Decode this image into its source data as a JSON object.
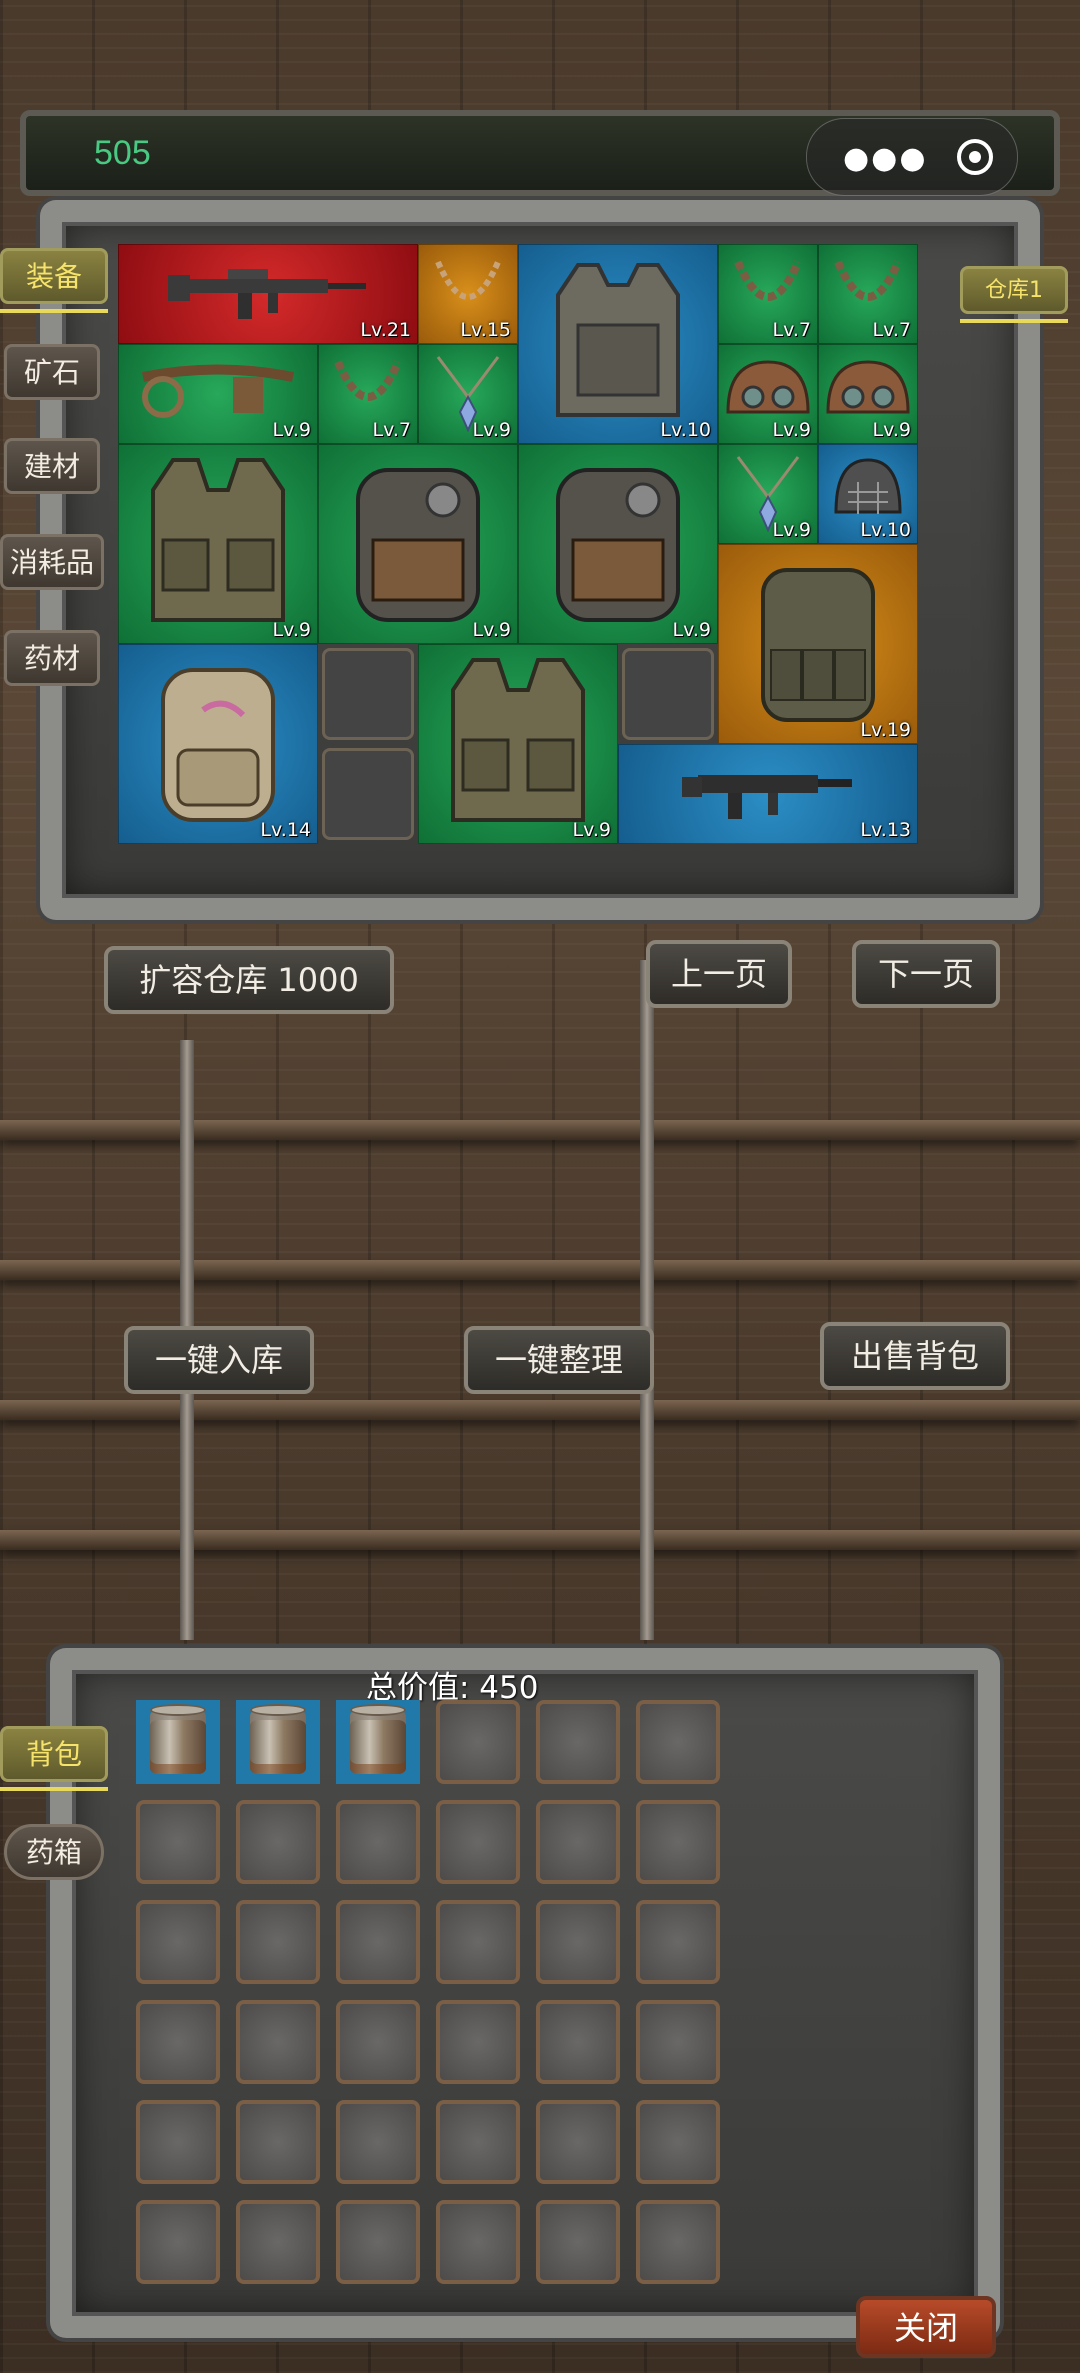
{
  "top_bar": {
    "coins": "505"
  },
  "left_tabs": [
    {
      "label": "装备",
      "active": true
    },
    {
      "label": "矿石",
      "active": false
    },
    {
      "label": "建材",
      "active": false
    },
    {
      "label": "消耗品",
      "active": false
    },
    {
      "label": "药材",
      "active": false
    }
  ],
  "warehouse_tab": {
    "label": "仓库1"
  },
  "items": [
    {
      "name": "rifle-icon",
      "lv": "Lv.21",
      "bg": "red"
    },
    {
      "name": "necklace-icon",
      "lv": "Lv.15",
      "bg": "orange"
    },
    {
      "name": "armor-vest-icon",
      "lv": "Lv.10",
      "bg": "blue"
    },
    {
      "name": "necklace-icon",
      "lv": "Lv.7",
      "bg": "green"
    },
    {
      "name": "necklace-icon",
      "lv": "Lv.7",
      "bg": "green"
    },
    {
      "name": "belt-icon",
      "lv": "Lv.9",
      "bg": "green"
    },
    {
      "name": "necklace-icon",
      "lv": "Lv.7",
      "bg": "green"
    },
    {
      "name": "crystal-pendant-icon",
      "lv": "Lv.9",
      "bg": "green"
    },
    {
      "name": "helmet-icon",
      "lv": "Lv.9",
      "bg": "green"
    },
    {
      "name": "helmet-icon",
      "lv": "Lv.9",
      "bg": "green"
    },
    {
      "name": "tactical-vest-icon",
      "lv": "Lv.9",
      "bg": "green"
    },
    {
      "name": "tool-backpack-icon",
      "lv": "Lv.9",
      "bg": "green"
    },
    {
      "name": "tool-backpack-icon",
      "lv": "Lv.9",
      "bg": "green"
    },
    {
      "name": "crystal-pendant-icon",
      "lv": "Lv.9",
      "bg": "green"
    },
    {
      "name": "cage-helmet-icon",
      "lv": "Lv.10",
      "bg": "blue"
    },
    {
      "name": "military-backpack-icon",
      "lv": "Lv.19",
      "bg": "orange"
    },
    {
      "name": "camo-backpack-icon",
      "lv": "Lv.14",
      "bg": "blue"
    },
    {
      "name": "tactical-vest-icon",
      "lv": "Lv.9",
      "bg": "green"
    },
    {
      "name": "smg-icon",
      "lv": "Lv.13",
      "bg": "blue"
    }
  ],
  "buttons": {
    "expand": "扩容仓库 1000",
    "prev": "上一页",
    "next": "下一页",
    "store_all": "一键入库",
    "sort_all": "一键整理",
    "sell_bag": "出售背包",
    "close": "关闭"
  },
  "bag": {
    "total_value": "总价值: 450",
    "tabs": [
      {
        "label": "背包",
        "active": true
      },
      {
        "label": "药箱",
        "active": false
      }
    ],
    "filled_slots": 3,
    "slot_item": "tin-can-icon"
  }
}
